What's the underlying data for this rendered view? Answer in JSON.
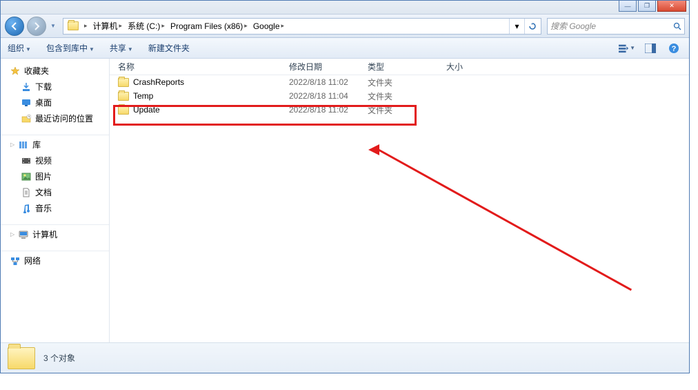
{
  "breadcrumb": {
    "items": [
      {
        "label": "计算机"
      },
      {
        "label": "系统 (C:)"
      },
      {
        "label": "Program Files (x86)"
      },
      {
        "label": "Google"
      }
    ]
  },
  "search": {
    "placeholder": "搜索 Google"
  },
  "toolbar": {
    "organize": "组织",
    "include": "包含到库中",
    "share": "共享",
    "newfolder": "新建文件夹"
  },
  "sidebar": {
    "favorites": {
      "label": "收藏夹",
      "download": "下载",
      "desktop": "桌面",
      "recent": "最近访问的位置"
    },
    "libs": {
      "label": "库",
      "videos": "视频",
      "pictures": "图片",
      "docs": "文档",
      "music": "音乐"
    },
    "computer": "计算机",
    "network": "网络"
  },
  "columns": {
    "name": "名称",
    "date": "修改日期",
    "type": "类型",
    "size": "大小"
  },
  "rows": [
    {
      "name": "CrashReports",
      "date": "2022/8/18 11:02",
      "type": "文件夹"
    },
    {
      "name": "Temp",
      "date": "2022/8/18 11:04",
      "type": "文件夹"
    },
    {
      "name": "Update",
      "date": "2022/8/18 11:02",
      "type": "文件夹"
    }
  ],
  "status": {
    "text": "3 个对象"
  }
}
